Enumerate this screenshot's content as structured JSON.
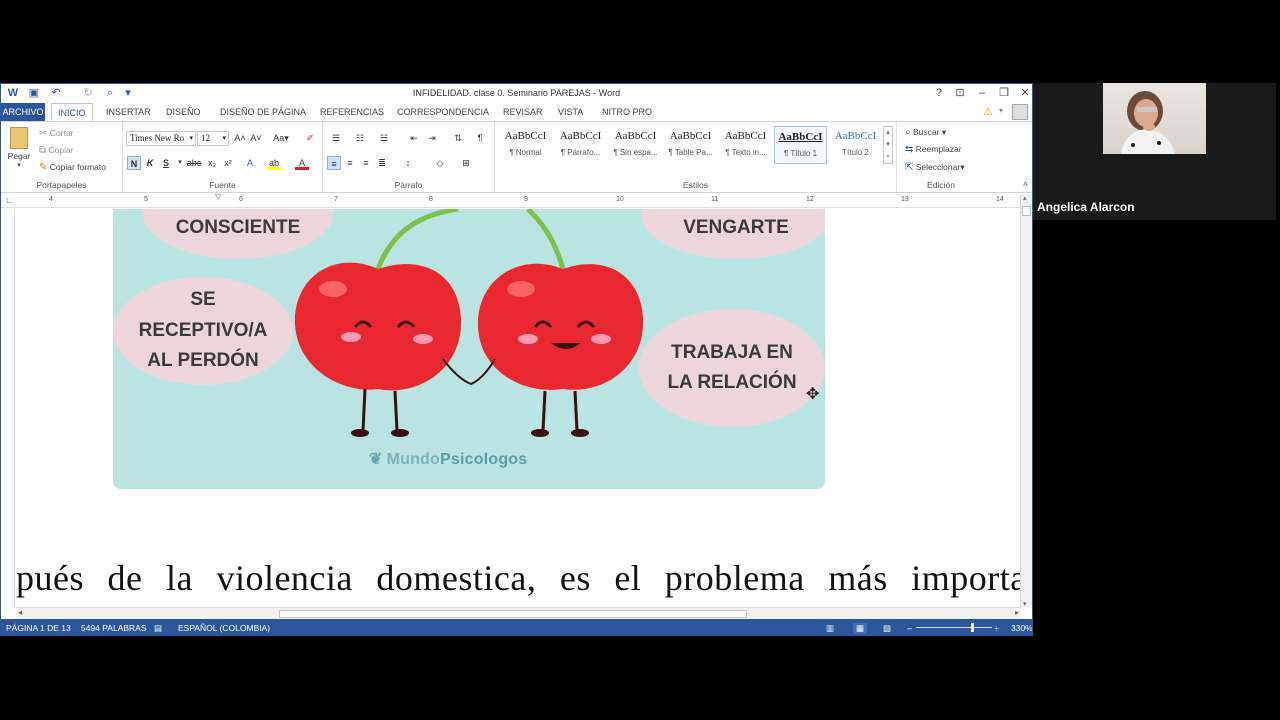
{
  "window": {
    "title": "INFIDELIDAD. clase 0. Seminario PAREJAS - Word",
    "help": "?",
    "controls": [
      "⊡",
      "–",
      "❐",
      "✕"
    ]
  },
  "tabs": [
    {
      "label": "ARCHIVO",
      "file": true
    },
    {
      "label": "INICIO",
      "active": true
    },
    {
      "label": "INSERTAR"
    },
    {
      "label": "DISEÑO"
    },
    {
      "label": "DISEÑO DE PÁGINA"
    },
    {
      "label": "REFERENCIAS"
    },
    {
      "label": "CORRESPONDENCIA"
    },
    {
      "label": "REVISAR"
    },
    {
      "label": "VISTA"
    },
    {
      "label": "NITRO PRO"
    }
  ],
  "ribbon": {
    "clipboard": {
      "label": "Portapapeles",
      "paste": "Pegar",
      "cut": "Cortar",
      "copy": "Copiar",
      "format_painter": "Copiar formato"
    },
    "font": {
      "label": "Fuente",
      "font_name": "Times New Ro",
      "font_size": "12"
    },
    "paragraph": {
      "label": "Párrafo"
    },
    "styles": {
      "label": "Estilos",
      "items": [
        {
          "sample": "AaBbCcI",
          "name": "¶ Normal"
        },
        {
          "sample": "AaBbCcI",
          "name": "¶ Párrafo..."
        },
        {
          "sample": "AaBbCcI",
          "name": "¶ Sin espa..."
        },
        {
          "sample": "AaBbCcI",
          "name": "¶ Table Pa..."
        },
        {
          "sample": "AaBbCcI",
          "name": "¶ Texto in..."
        },
        {
          "sample": "AaBbCcI",
          "name": "¶ Título 1",
          "selected": true
        },
        {
          "sample": "AaBbCcI",
          "name": "Título 2"
        }
      ]
    },
    "editing": {
      "label": "Edición",
      "find": "Buscar",
      "replace": "Reemplazar",
      "select": "Seleccionar"
    }
  },
  "ruler": {
    "marks": [
      "4",
      "5",
      "6",
      "7",
      "8",
      "9",
      "10",
      "11",
      "12",
      "13",
      "14"
    ]
  },
  "document": {
    "image": {
      "bubbles": [
        "CONSCIENTE",
        "VENGARTE",
        "SE RECEPTIVO/A AL PERDÓN",
        "TRABAJA EN LA RELACIÓN"
      ],
      "brand_a": "Mundo",
      "brand_b": "Psicologos"
    },
    "body_text": "pués de la violencia domestica, es el problema más importa"
  },
  "status": {
    "page": "PÁGINA 1 DE 13",
    "words": "5494 PALABRAS",
    "language": "ESPAÑOL (COLOMBIA)",
    "zoom": "330%"
  },
  "video": {
    "participant": "Angelica Alarcon"
  },
  "colors": {
    "accent": "#2b579a",
    "teal": "#b9e4e1",
    "bubble": "#ecd6dc",
    "cherry": "#e8282e"
  }
}
